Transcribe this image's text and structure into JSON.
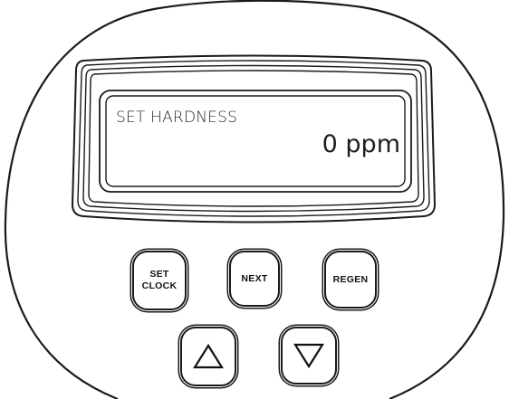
{
  "display": {
    "label": "SET HARDNESS",
    "value": "0 ppm"
  },
  "buttons": {
    "set_clock": {
      "line1": "SET",
      "line2": "CLOCK"
    },
    "next": {
      "label": "NEXT"
    },
    "regen": {
      "label": "REGEN"
    },
    "up": {
      "icon": "up-triangle-icon"
    },
    "down": {
      "icon": "down-triangle-icon"
    }
  },
  "colors": {
    "outline": "#1a1a1a",
    "background": "#ffffff"
  }
}
